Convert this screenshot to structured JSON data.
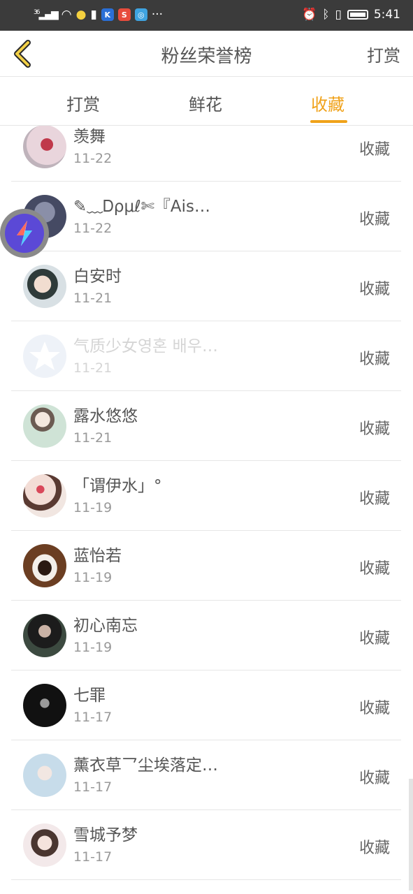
{
  "status_bar": {
    "signal": "36",
    "time": "5:41"
  },
  "header": {
    "title": "粉丝荣誉榜",
    "right_action": "打赏"
  },
  "tabs": [
    {
      "label": "打赏",
      "active": false
    },
    {
      "label": "鲜花",
      "active": false
    },
    {
      "label": "收藏",
      "active": true
    }
  ],
  "colors": {
    "accent": "#f0a21a",
    "status_bar": "#3b3b3b"
  },
  "items": [
    {
      "name": "羡舞",
      "date": "11-22",
      "action": "收藏"
    },
    {
      "name": "✎﹏Ꭰρμℓ✄『Ais…",
      "date": "11-22",
      "action": "收藏"
    },
    {
      "name": "白安时",
      "date": "11-21",
      "action": "收藏"
    },
    {
      "name": "气质少女영혼 배우…",
      "date": "11-21",
      "action": "收藏"
    },
    {
      "name": "露水悠悠",
      "date": "11-21",
      "action": "收藏"
    },
    {
      "name": "「谓伊水」°",
      "date": "11-19",
      "action": "收藏"
    },
    {
      "name": "蓝怡若",
      "date": "11-19",
      "action": "收藏"
    },
    {
      "name": "初心南忘",
      "date": "11-19",
      "action": "收藏"
    },
    {
      "name": "七罪",
      "date": "11-17",
      "action": "收藏"
    },
    {
      "name": "薰衣草乛尘埃落定…",
      "date": "11-17",
      "action": "收藏"
    },
    {
      "name": "雪城予梦",
      "date": "11-17",
      "action": "收藏"
    }
  ]
}
